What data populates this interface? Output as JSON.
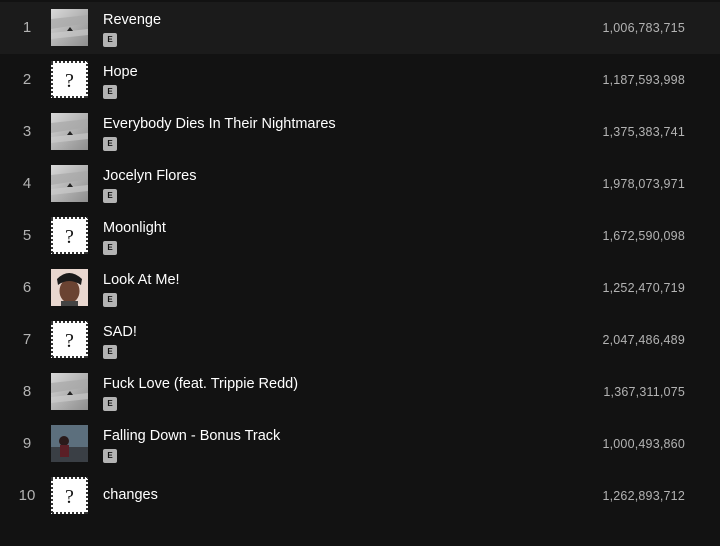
{
  "tracks": [
    {
      "num": "1",
      "title": "Revenge",
      "explicit": "E",
      "plays": "1,006,783,715",
      "art": "album-17"
    },
    {
      "num": "2",
      "title": "Hope",
      "explicit": "E",
      "plays": "1,187,593,998",
      "art": "album-question-mark"
    },
    {
      "num": "3",
      "title": "Everybody Dies In Their Nightmares",
      "explicit": "E",
      "plays": "1,375,383,741",
      "art": "album-17"
    },
    {
      "num": "4",
      "title": "Jocelyn Flores",
      "explicit": "E",
      "plays": "1,978,073,971",
      "art": "album-17"
    },
    {
      "num": "5",
      "title": "Moonlight",
      "explicit": "E",
      "plays": "1,672,590,098",
      "art": "album-question-mark"
    },
    {
      "num": "6",
      "title": "Look At Me!",
      "explicit": "E",
      "plays": "1,252,470,719",
      "art": "single-portrait"
    },
    {
      "num": "7",
      "title": "SAD!",
      "explicit": "E",
      "plays": "2,047,486,489",
      "art": "album-question-mark"
    },
    {
      "num": "8",
      "title": "Fuck Love (feat. Trippie Redd)",
      "explicit": "E",
      "plays": "1,367,311,075",
      "art": "album-17"
    },
    {
      "num": "9",
      "title": "Falling Down - Bonus Track",
      "explicit": "E",
      "plays": "1,000,493,860",
      "art": "single-figure"
    },
    {
      "num": "10",
      "title": "changes",
      "explicit": "",
      "plays": "1,262,893,712",
      "art": "album-question-mark"
    }
  ],
  "colors": {
    "background": "#121212",
    "hover_row": "#1b1b1b",
    "title": "#ffffff",
    "secondary": "#b3b3b3"
  }
}
